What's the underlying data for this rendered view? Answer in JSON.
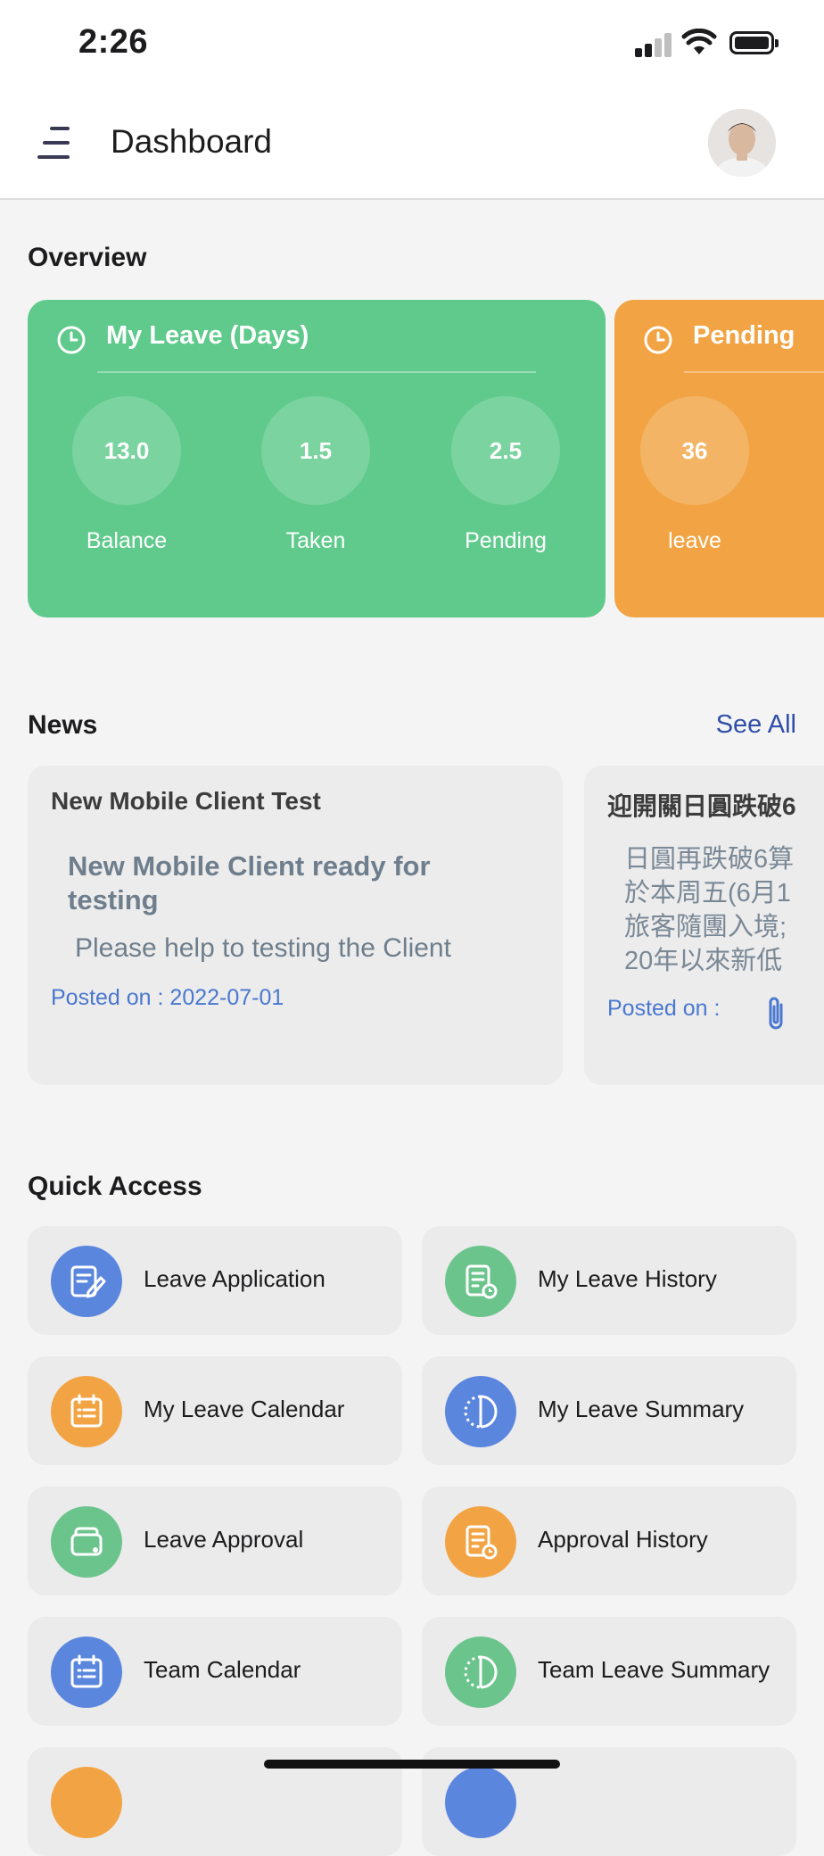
{
  "status_bar": {
    "time": "2:26"
  },
  "header": {
    "title": "Dashboard"
  },
  "overview": {
    "title": "Overview",
    "cards": [
      {
        "title": "My Leave (Days)",
        "color": "#5fca8c",
        "stats": [
          {
            "value": "13.0",
            "label": "Balance"
          },
          {
            "value": "1.5",
            "label": "Taken"
          },
          {
            "value": "2.5",
            "label": "Pending"
          }
        ]
      },
      {
        "title": "Pending",
        "color": "#f2a444",
        "stats": [
          {
            "value": "36",
            "label": "leave"
          }
        ]
      }
    ]
  },
  "news": {
    "title": "News",
    "see_all": "See All",
    "items": [
      {
        "title": "New Mobile Client Test",
        "headline": "New Mobile Client ready for testing",
        "body": "Please help to testing the Client",
        "posted": "Posted on : 2022-07-01"
      },
      {
        "title": "迎開關日圓跌破6",
        "body": "日圓再跌破6算\n於本周五(6月1\n旅客隨團入境;\n20年以來新低",
        "posted": "Posted on :"
      }
    ]
  },
  "quick_access": {
    "title": "Quick Access",
    "items": [
      {
        "label": "Leave Application",
        "icon": "leave-application-icon",
        "color": "#5b86de"
      },
      {
        "label": "My Leave History",
        "icon": "leave-history-icon",
        "color": "#6cc48d"
      },
      {
        "label": "My Leave Calendar",
        "icon": "calendar-icon",
        "color": "#f2a444"
      },
      {
        "label": "My Leave Summary",
        "icon": "summary-icon",
        "color": "#5b86de"
      },
      {
        "label": "Leave Approval",
        "icon": "wallet-icon",
        "color": "#6cc48d"
      },
      {
        "label": "Approval History",
        "icon": "approval-history-icon",
        "color": "#f2a444"
      },
      {
        "label": "Team Calendar",
        "icon": "team-calendar-icon",
        "color": "#5b86de"
      },
      {
        "label": "Team Leave Summary",
        "icon": "team-summary-icon",
        "color": "#6cc48d"
      }
    ]
  }
}
